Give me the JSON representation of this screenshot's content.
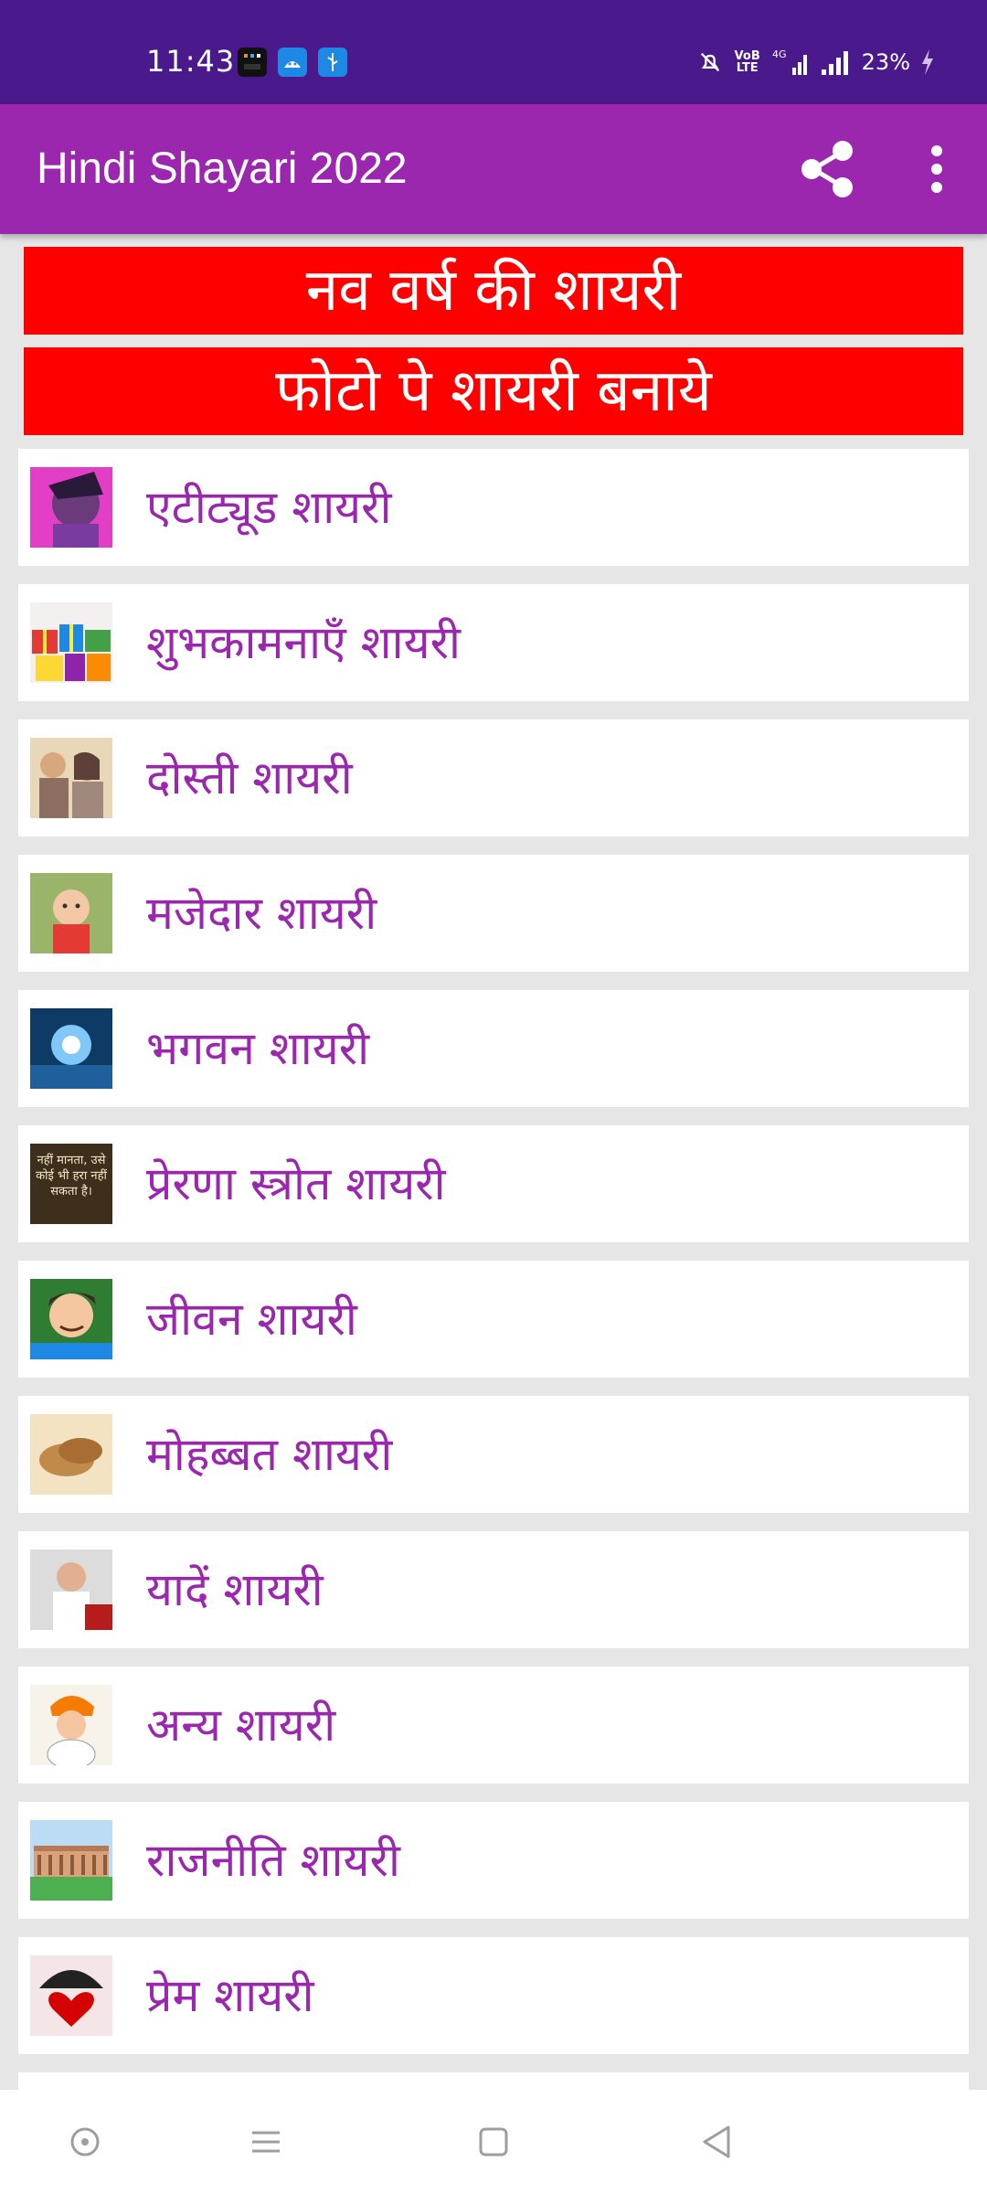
{
  "status_bar": {
    "time": "11:43",
    "battery": "23%",
    "volte_label": "VoB LTE",
    "net_label": "4G"
  },
  "app_bar": {
    "title": "Hindi Shayari 2022",
    "share_icon": "share-icon",
    "overflow_icon": "more-vert-icon"
  },
  "banners": [
    {
      "label": "नव वर्ष की शायरी"
    },
    {
      "label": "फोटो पे शायरी बनाये"
    }
  ],
  "categories": [
    {
      "label": "एटीट्यूड शायरी"
    },
    {
      "label": "शुभकामनाएँ शायरी"
    },
    {
      "label": "दोस्ती शायरी"
    },
    {
      "label": "मजेदार शायरी"
    },
    {
      "label": "भगवन शायरी"
    },
    {
      "label": "प्रेरणा स्त्रोत शायरी",
      "thumb_text": "नहीं मानता, उसे कोई भी हरा नहीं सकता है।"
    },
    {
      "label": "जीवन शायरी"
    },
    {
      "label": "मोहब्बत शायरी"
    },
    {
      "label": "यादें शायरी"
    },
    {
      "label": "अन्य शायरी"
    },
    {
      "label": "राजनीति शायरी"
    },
    {
      "label": "प्रेम शायरी"
    }
  ],
  "colors": {
    "status_bar": "#4a1a8c",
    "app_bar": "#9b27af",
    "banner": "#ff0000",
    "label": "#9b27af"
  },
  "nav_icons": [
    "recents-dot-icon",
    "menu-icon",
    "home-square-icon",
    "back-triangle-icon"
  ]
}
